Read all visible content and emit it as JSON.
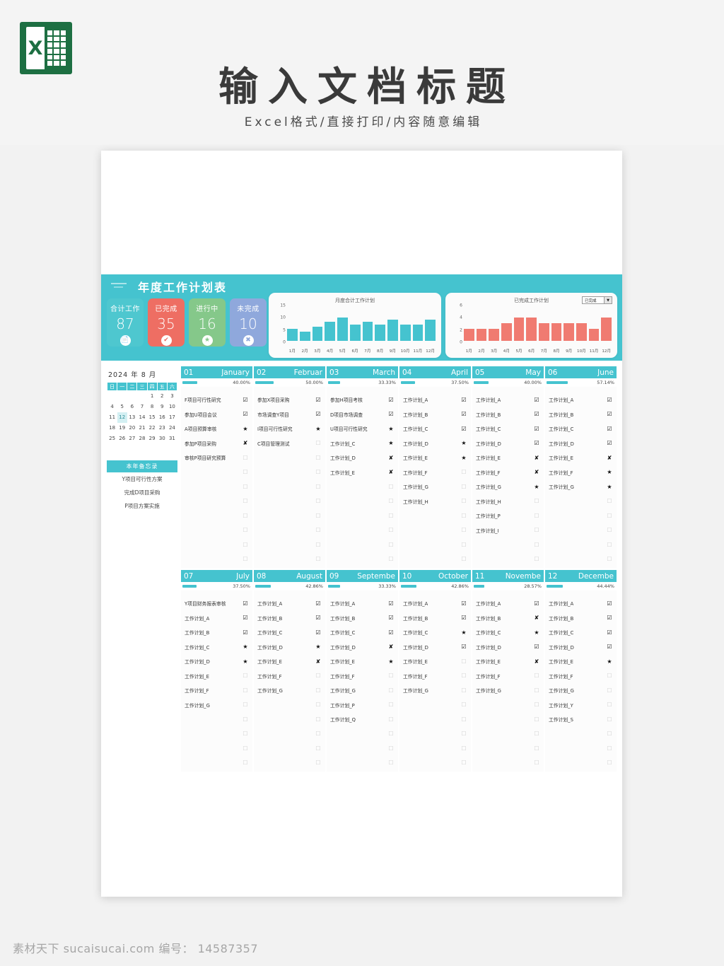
{
  "banner": {
    "logo_icon": "excel-logo-icon",
    "title": "输入文档标题",
    "subtitle": "Excel格式/直接打印/内容随意编辑"
  },
  "watermark": "素材天下 sucaisucai.com  编号： 14587357",
  "sheet": {
    "header_title": "年度工作计划表",
    "stats": [
      {
        "label": "合计工作",
        "value": "87",
        "color": "#4ec7cf",
        "icon": "document-icon",
        "glyph": "📄"
      },
      {
        "label": "已完成",
        "value": "35",
        "color": "#ee6e63",
        "icon": "check-icon",
        "glyph": "✔"
      },
      {
        "label": "进行中",
        "value": "16",
        "color": "#85c88a",
        "icon": "star-icon",
        "glyph": "★"
      },
      {
        "label": "未完成",
        "value": "10",
        "color": "#8fa8dc",
        "icon": "cross-icon",
        "glyph": "✖"
      }
    ],
    "calendar": {
      "title": "2024 年 8 月",
      "weekdays": [
        "日",
        "一",
        "二",
        "三",
        "四",
        "五",
        "六"
      ],
      "weeks": [
        [
          "",
          "",
          "",
          "",
          "1",
          "2",
          "3"
        ],
        [
          "4",
          "5",
          "6",
          "7",
          "8",
          "9",
          "10"
        ],
        [
          "11",
          "12",
          "13",
          "14",
          "15",
          "16",
          "17"
        ],
        [
          "18",
          "19",
          "20",
          "21",
          "22",
          "23",
          "24"
        ],
        [
          "25",
          "26",
          "27",
          "28",
          "29",
          "30",
          "31"
        ]
      ],
      "highlight": "12"
    },
    "memo": {
      "title": "本年备忘录",
      "items": [
        "Y项目可行性方案",
        "完成D项目采购",
        "P项目方案实施"
      ]
    },
    "months": [
      {
        "num": "01",
        "name": "January",
        "pct": "40.00%",
        "pct_val": 40,
        "tasks": [
          {
            "name": "F项目可行性研究",
            "mark": "☑"
          },
          {
            "name": "参加U项目会议",
            "mark": "☑"
          },
          {
            "name": "A项目预算审核",
            "mark": "★"
          },
          {
            "name": "参加P项目采购",
            "mark": "✘"
          },
          {
            "name": "审核P项目研究预算",
            "mark": "☐"
          },
          {
            "name": "",
            "mark": "☐"
          },
          {
            "name": "",
            "mark": "☐"
          },
          {
            "name": "",
            "mark": "☐"
          },
          {
            "name": "",
            "mark": "☐"
          },
          {
            "name": "",
            "mark": "☐"
          },
          {
            "name": "",
            "mark": "☐"
          },
          {
            "name": "",
            "mark": "☐"
          }
        ]
      },
      {
        "num": "02",
        "name": "Februar",
        "pct": "50.00%",
        "pct_val": 50,
        "tasks": [
          {
            "name": "参加X项目采购",
            "mark": "☑"
          },
          {
            "name": "市场调查Y项目",
            "mark": "☑"
          },
          {
            "name": "I项目可行性研究",
            "mark": "★"
          },
          {
            "name": "C项目管理测试",
            "mark": "☐"
          },
          {
            "name": "",
            "mark": "☐"
          },
          {
            "name": "",
            "mark": "☐"
          },
          {
            "name": "",
            "mark": "☐"
          },
          {
            "name": "",
            "mark": "☐"
          },
          {
            "name": "",
            "mark": "☐"
          },
          {
            "name": "",
            "mark": "☐"
          },
          {
            "name": "",
            "mark": "☐"
          },
          {
            "name": "",
            "mark": "☐"
          }
        ]
      },
      {
        "num": "03",
        "name": "March",
        "pct": "33.33%",
        "pct_val": 33.33,
        "tasks": [
          {
            "name": "参加H项目考核",
            "mark": "☑"
          },
          {
            "name": "D项目市场调查",
            "mark": "☑"
          },
          {
            "name": "U项目可行性研究",
            "mark": "★"
          },
          {
            "name": "工作计划_C",
            "mark": "★"
          },
          {
            "name": "工作计划_D",
            "mark": "✘"
          },
          {
            "name": "工作计划_E",
            "mark": "✘"
          },
          {
            "name": "",
            "mark": "☐"
          },
          {
            "name": "",
            "mark": "☐"
          },
          {
            "name": "",
            "mark": "☐"
          },
          {
            "name": "",
            "mark": "☐"
          },
          {
            "name": "",
            "mark": "☐"
          },
          {
            "name": "",
            "mark": "☐"
          }
        ]
      },
      {
        "num": "04",
        "name": "April",
        "pct": "37.50%",
        "pct_val": 37.5,
        "tasks": [
          {
            "name": "工作计划_A",
            "mark": "☑"
          },
          {
            "name": "工作计划_B",
            "mark": "☑"
          },
          {
            "name": "工作计划_C",
            "mark": "☑"
          },
          {
            "name": "工作计划_D",
            "mark": "★"
          },
          {
            "name": "工作计划_E",
            "mark": "★"
          },
          {
            "name": "工作计划_F",
            "mark": "☐"
          },
          {
            "name": "工作计划_G",
            "mark": "☐"
          },
          {
            "name": "工作计划_H",
            "mark": "☐"
          },
          {
            "name": "",
            "mark": "☐"
          },
          {
            "name": "",
            "mark": "☐"
          },
          {
            "name": "",
            "mark": "☐"
          },
          {
            "name": "",
            "mark": "☐"
          }
        ]
      },
      {
        "num": "05",
        "name": "May",
        "pct": "40.00%",
        "pct_val": 40,
        "tasks": [
          {
            "name": "工作计划_A",
            "mark": "☑"
          },
          {
            "name": "工作计划_B",
            "mark": "☑"
          },
          {
            "name": "工作计划_C",
            "mark": "☑"
          },
          {
            "name": "工作计划_D",
            "mark": "☑"
          },
          {
            "name": "工作计划_E",
            "mark": "✘"
          },
          {
            "name": "工作计划_F",
            "mark": "✘"
          },
          {
            "name": "工作计划_G",
            "mark": "★"
          },
          {
            "name": "工作计划_H",
            "mark": "☐"
          },
          {
            "name": "工作计划_P",
            "mark": "☐"
          },
          {
            "name": "工作计划_I",
            "mark": "☐"
          },
          {
            "name": "",
            "mark": "☐"
          },
          {
            "name": "",
            "mark": "☐"
          }
        ]
      },
      {
        "num": "06",
        "name": "June",
        "pct": "57.14%",
        "pct_val": 57.14,
        "tasks": [
          {
            "name": "工作计划_A",
            "mark": "☑"
          },
          {
            "name": "工作计划_B",
            "mark": "☑"
          },
          {
            "name": "工作计划_C",
            "mark": "☑"
          },
          {
            "name": "工作计划_D",
            "mark": "☑"
          },
          {
            "name": "工作计划_E",
            "mark": "✘"
          },
          {
            "name": "工作计划_F",
            "mark": "★"
          },
          {
            "name": "工作计划_G",
            "mark": "★"
          },
          {
            "name": "",
            "mark": "☐"
          },
          {
            "name": "",
            "mark": "☐"
          },
          {
            "name": "",
            "mark": "☐"
          },
          {
            "name": "",
            "mark": "☐"
          },
          {
            "name": "",
            "mark": "☐"
          }
        ]
      },
      {
        "num": "07",
        "name": "July",
        "pct": "37.50%",
        "pct_val": 37.5,
        "tasks": [
          {
            "name": "Y项目财务报表审核",
            "mark": "☑"
          },
          {
            "name": "工作计划_A",
            "mark": "☑"
          },
          {
            "name": "工作计划_B",
            "mark": "☑"
          },
          {
            "name": "工作计划_C",
            "mark": "★"
          },
          {
            "name": "工作计划_D",
            "mark": "★"
          },
          {
            "name": "工作计划_E",
            "mark": "☐"
          },
          {
            "name": "工作计划_F",
            "mark": "☐"
          },
          {
            "name": "工作计划_G",
            "mark": "☐"
          },
          {
            "name": "",
            "mark": "☐"
          },
          {
            "name": "",
            "mark": "☐"
          },
          {
            "name": "",
            "mark": "☐"
          },
          {
            "name": "",
            "mark": "☐"
          }
        ]
      },
      {
        "num": "08",
        "name": "August",
        "pct": "42.86%",
        "pct_val": 42.86,
        "tasks": [
          {
            "name": "工作计划_A",
            "mark": "☑"
          },
          {
            "name": "工作计划_B",
            "mark": "☑"
          },
          {
            "name": "工作计划_C",
            "mark": "☑"
          },
          {
            "name": "工作计划_D",
            "mark": "★"
          },
          {
            "name": "工作计划_E",
            "mark": "✘"
          },
          {
            "name": "工作计划_F",
            "mark": "☐"
          },
          {
            "name": "工作计划_G",
            "mark": "☐"
          },
          {
            "name": "",
            "mark": "☐"
          },
          {
            "name": "",
            "mark": "☐"
          },
          {
            "name": "",
            "mark": "☐"
          },
          {
            "name": "",
            "mark": "☐"
          },
          {
            "name": "",
            "mark": "☐"
          }
        ]
      },
      {
        "num": "09",
        "name": "Septembe",
        "pct": "33.33%",
        "pct_val": 33.33,
        "tasks": [
          {
            "name": "工作计划_A",
            "mark": "☑"
          },
          {
            "name": "工作计划_B",
            "mark": "☑"
          },
          {
            "name": "工作计划_C",
            "mark": "☑"
          },
          {
            "name": "工作计划_D",
            "mark": "✘"
          },
          {
            "name": "工作计划_E",
            "mark": "★"
          },
          {
            "name": "工作计划_F",
            "mark": "☐"
          },
          {
            "name": "工作计划_G",
            "mark": "☐"
          },
          {
            "name": "工作计划_P",
            "mark": "☐"
          },
          {
            "name": "工作计划_Q",
            "mark": "☐"
          },
          {
            "name": "",
            "mark": "☐"
          },
          {
            "name": "",
            "mark": "☐"
          },
          {
            "name": "",
            "mark": "☐"
          }
        ]
      },
      {
        "num": "10",
        "name": "October",
        "pct": "42.86%",
        "pct_val": 42.86,
        "tasks": [
          {
            "name": "工作计划_A",
            "mark": "☑"
          },
          {
            "name": "工作计划_B",
            "mark": "☑"
          },
          {
            "name": "工作计划_C",
            "mark": "★"
          },
          {
            "name": "工作计划_D",
            "mark": "☑"
          },
          {
            "name": "工作计划_E",
            "mark": "☐"
          },
          {
            "name": "工作计划_F",
            "mark": "☐"
          },
          {
            "name": "工作计划_G",
            "mark": "☐"
          },
          {
            "name": "",
            "mark": "☐"
          },
          {
            "name": "",
            "mark": "☐"
          },
          {
            "name": "",
            "mark": "☐"
          },
          {
            "name": "",
            "mark": "☐"
          },
          {
            "name": "",
            "mark": "☐"
          }
        ]
      },
      {
        "num": "11",
        "name": "Novembe",
        "pct": "28.57%",
        "pct_val": 28.57,
        "tasks": [
          {
            "name": "工作计划_A",
            "mark": "☑"
          },
          {
            "name": "工作计划_B",
            "mark": "✘"
          },
          {
            "name": "工作计划_C",
            "mark": "★"
          },
          {
            "name": "工作计划_D",
            "mark": "☑"
          },
          {
            "name": "工作计划_E",
            "mark": "✘"
          },
          {
            "name": "工作计划_F",
            "mark": "☐"
          },
          {
            "name": "工作计划_G",
            "mark": "☐"
          },
          {
            "name": "",
            "mark": "☐"
          },
          {
            "name": "",
            "mark": "☐"
          },
          {
            "name": "",
            "mark": "☐"
          },
          {
            "name": "",
            "mark": "☐"
          },
          {
            "name": "",
            "mark": "☐"
          }
        ]
      },
      {
        "num": "12",
        "name": "Decembe",
        "pct": "44.44%",
        "pct_val": 44.44,
        "tasks": [
          {
            "name": "工作计划_A",
            "mark": "☑"
          },
          {
            "name": "工作计划_B",
            "mark": "☑"
          },
          {
            "name": "工作计划_C",
            "mark": "☑"
          },
          {
            "name": "工作计划_D",
            "mark": "☑"
          },
          {
            "name": "工作计划_E",
            "mark": "★"
          },
          {
            "name": "工作计划_F",
            "mark": "☐"
          },
          {
            "name": "工作计划_G",
            "mark": "☐"
          },
          {
            "name": "工作计划_Y",
            "mark": "☐"
          },
          {
            "name": "工作计划_S",
            "mark": "☐"
          },
          {
            "name": "",
            "mark": "☐"
          },
          {
            "name": "",
            "mark": "☐"
          },
          {
            "name": "",
            "mark": "☐"
          }
        ]
      }
    ]
  },
  "chart_data": [
    {
      "type": "bar",
      "id": "monthly-total-plan",
      "title": "月度合计工作计划",
      "categories": [
        "1月",
        "2月",
        "3月",
        "4月",
        "5月",
        "6月",
        "7月",
        "8月",
        "9月",
        "10月",
        "11月",
        "12月"
      ],
      "values": [
        5,
        4,
        6,
        8,
        10,
        7,
        8,
        7,
        9,
        7,
        7,
        9
      ],
      "yticks": [
        0,
        5,
        10,
        15
      ],
      "ylim": [
        0,
        15
      ],
      "xlabel": "",
      "ylabel": "",
      "grid": false,
      "color": "#45c3cf",
      "legend": "none"
    },
    {
      "type": "bar",
      "id": "completed-plan",
      "title": "已完成工作计划",
      "categories": [
        "1月",
        "2月",
        "3月",
        "4月",
        "5月",
        "6月",
        "7月",
        "8月",
        "9月",
        "10月",
        "11月",
        "12月"
      ],
      "values": [
        2,
        2,
        2,
        3,
        4,
        4,
        3,
        3,
        3,
        3,
        2,
        4
      ],
      "yticks": [
        0,
        2,
        4,
        6
      ],
      "ylim": [
        0,
        6
      ],
      "xlabel": "",
      "ylabel": "",
      "grid": false,
      "color": "#f07b71",
      "legend": "none",
      "selector_value": "已完成"
    }
  ]
}
